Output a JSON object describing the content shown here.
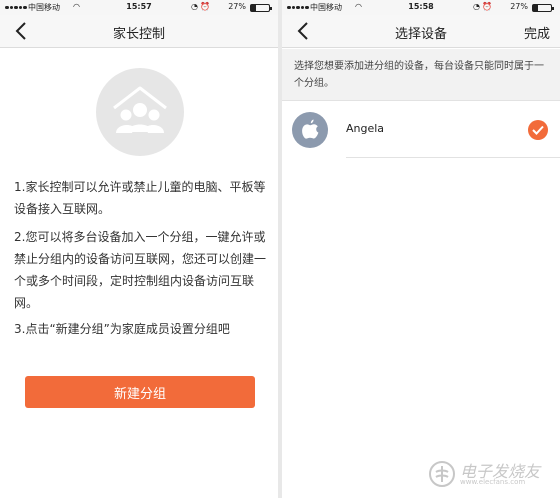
{
  "left": {
    "statusbar": {
      "carrier": "中国移动",
      "time": "15:57",
      "battery": "27%",
      "battery_level": 0.27
    },
    "nav": {
      "title": "家长控制",
      "back_icon": "chevron-left-icon"
    },
    "hero_icon": "family-home-icon",
    "paragraphs": [
      "1.家长控制可以允许或禁止儿童的电脑、平板等设备接入互联网。",
      "2.您可以将多台设备加入一个分组，一键允许或禁止分组内的设备访问互联网，您还可以创建一个或多个时间段，定时控制组内设备访问互联网。",
      "3.点击“新建分组”为家庭成员设置分组吧"
    ],
    "button": "新建分组"
  },
  "right": {
    "statusbar": {
      "carrier": "中国移动",
      "time": "15:58",
      "battery": "27%",
      "battery_level": 0.27
    },
    "nav": {
      "title": "选择设备",
      "done": "完成",
      "back_icon": "chevron-left-icon"
    },
    "hint": "选择您想要添加进分组的设备，每台设备只能同时属于一个分组。",
    "devices": [
      {
        "name": "Angela",
        "icon": "apple-icon",
        "selected": true
      }
    ]
  },
  "watermark": {
    "text": "电子发烧友",
    "url": "www.elecfans.com"
  },
  "colors": {
    "accent": "#f26b3a",
    "navbar": "#f7f7f7",
    "avatar": "#8c9aae"
  }
}
